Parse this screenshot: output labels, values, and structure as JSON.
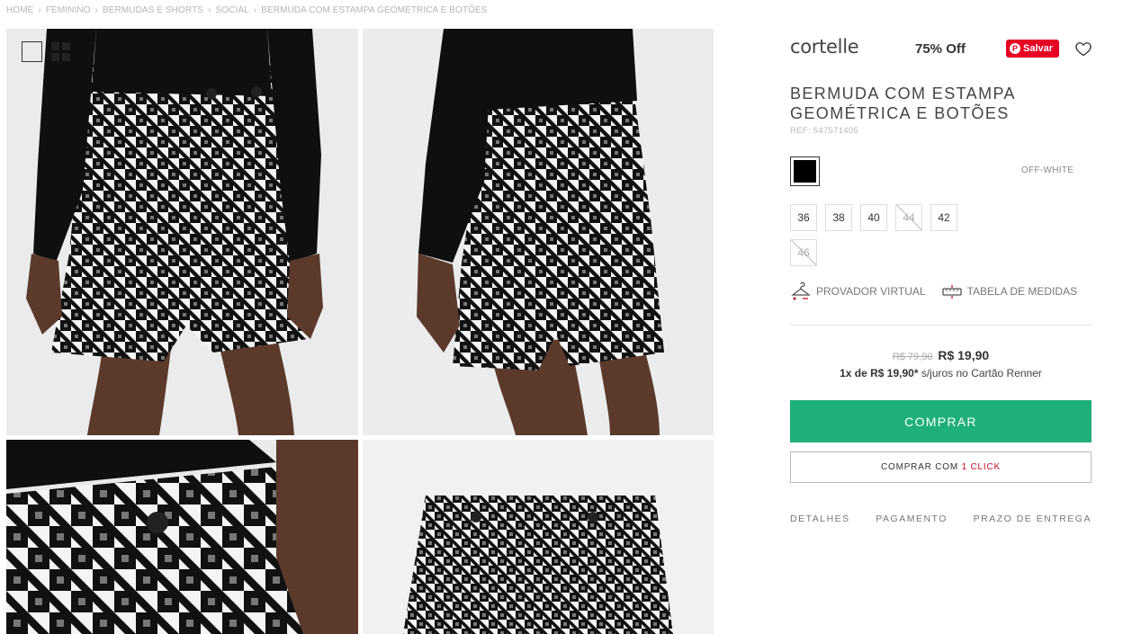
{
  "breadcrumb": [
    "HOME",
    "FEMININO",
    "BERMUDAS E SHORTS",
    "SOCIAL",
    "BERMUDA COM ESTAMPA GEOMÉTRICA E BOTÕES"
  ],
  "gallery": {
    "images": [
      {
        "label": "product-front"
      },
      {
        "label": "product-back"
      },
      {
        "label": "product-detail-button"
      },
      {
        "label": "product-flat"
      }
    ],
    "view_icons": [
      "single-view-icon",
      "grid-view-icon"
    ]
  },
  "product": {
    "brand": "cortelle",
    "discount": "75% Off",
    "pin_label": "Salvar",
    "title_line1": "BERMUDA COM ESTAMPA",
    "title_line2": "GEOMÉTRICA E BOTÕES",
    "ref": "REF: 547571405",
    "color_name": "OFF-WHITE",
    "swatch_color": "#000000",
    "sizes": [
      {
        "label": "36",
        "available": true
      },
      {
        "label": "38",
        "available": true
      },
      {
        "label": "40",
        "available": true
      },
      {
        "label": "44",
        "available": false
      },
      {
        "label": "42",
        "available": true
      },
      {
        "label": "46",
        "available": false
      }
    ],
    "tools": {
      "virtual_fitting": "PROVADOR VIRTUAL",
      "size_chart": "TABELA DE MEDIDAS"
    },
    "price": {
      "old": "R$ 79,90",
      "new": "R$ 19,90",
      "installment_bold": "1x de R$ 19,90*",
      "installment_rest": " s/juros no Cartão Renner"
    },
    "buy_label": "COMPRAR",
    "buy_one_click_prefix": "COMPRAR COM ",
    "buy_one_click_highlight": "1 CLICK",
    "tabs": [
      "DETALHES",
      "PAGAMENTO",
      "PRAZO DE ENTREGA"
    ]
  },
  "colors": {
    "buy_green": "#1fb079",
    "pinterest_red": "#e60023",
    "one_click_red": "#c8102e"
  }
}
